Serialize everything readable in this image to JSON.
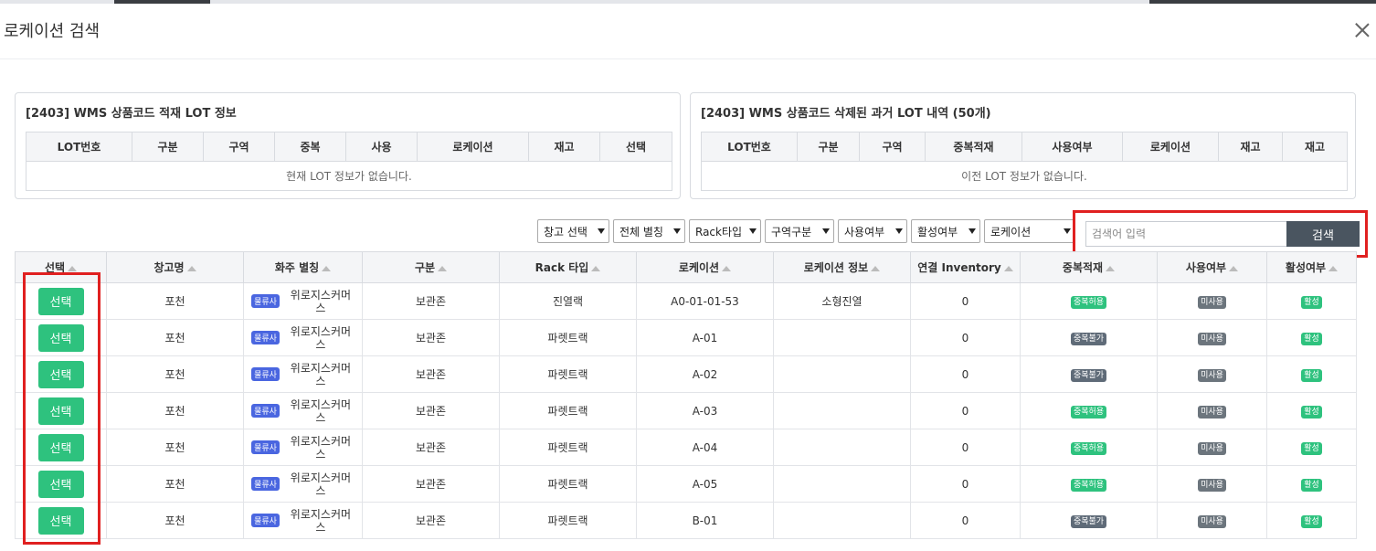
{
  "modal": {
    "title": "로케이션 검색"
  },
  "panel_current": {
    "title": "[2403] WMS 상품코드 적재 LOT 정보",
    "headers": [
      "LOT번호",
      "구분",
      "구역",
      "중복",
      "사용",
      "로케이션",
      "재고",
      "선택"
    ],
    "empty_message": "현재 LOT 정보가 없습니다."
  },
  "panel_history": {
    "title": "[2403] WMS 상품코드 삭제된 과거 LOT 내역 (50개)",
    "headers": [
      "LOT번호",
      "구분",
      "구역",
      "중복적재",
      "사용여부",
      "로케이션",
      "재고",
      "재고"
    ],
    "empty_message": "이전 LOT 정보가 없습니다."
  },
  "filters": [
    {
      "name": "warehouse-select",
      "value": "창고 선택"
    },
    {
      "name": "alias-select",
      "value": "전체 별칭"
    },
    {
      "name": "rack-type-select",
      "value": "Rack타입"
    },
    {
      "name": "zone-type-select",
      "value": "구역구분"
    },
    {
      "name": "usage-select",
      "value": "사용여부"
    },
    {
      "name": "active-select",
      "value": "활성여부"
    },
    {
      "name": "location-select",
      "value": "로케이션"
    }
  ],
  "search": {
    "placeholder": "검색어 입력",
    "button_label": "검색"
  },
  "table": {
    "headers": [
      "선택",
      "창고명",
      "화주 별칭",
      "구분",
      "Rack 타입",
      "로케이션",
      "로케이션 정보",
      "연결 Inventory",
      "중복적재",
      "사용여부",
      "활성여부"
    ],
    "rows": [
      {
        "select": "선택",
        "warehouse": "포천",
        "owner_badge": "물류사",
        "owner": "위로지스커머스",
        "type": "보관존",
        "rack": "진열랙",
        "location": "A0-01-01-53",
        "info": "소형진열",
        "inventory": "0",
        "dup": "중복허용",
        "dup_status": "allow",
        "use": "미사용",
        "active": "활성"
      },
      {
        "select": "선택",
        "warehouse": "포천",
        "owner_badge": "물류사",
        "owner": "위로지스커머스",
        "type": "보관존",
        "rack": "파렛트랙",
        "location": "A-01",
        "info": "",
        "inventory": "0",
        "dup": "중복불가",
        "dup_status": "deny",
        "use": "미사용",
        "active": "활성"
      },
      {
        "select": "선택",
        "warehouse": "포천",
        "owner_badge": "물류사",
        "owner": "위로지스커머스",
        "type": "보관존",
        "rack": "파렛트랙",
        "location": "A-02",
        "info": "",
        "inventory": "0",
        "dup": "중복불가",
        "dup_status": "deny",
        "use": "미사용",
        "active": "활성"
      },
      {
        "select": "선택",
        "warehouse": "포천",
        "owner_badge": "물류사",
        "owner": "위로지스커머스",
        "type": "보관존",
        "rack": "파렛트랙",
        "location": "A-03",
        "info": "",
        "inventory": "0",
        "dup": "중복허용",
        "dup_status": "allow",
        "use": "미사용",
        "active": "활성"
      },
      {
        "select": "선택",
        "warehouse": "포천",
        "owner_badge": "물류사",
        "owner": "위로지스커머스",
        "type": "보관존",
        "rack": "파렛트랙",
        "location": "A-04",
        "info": "",
        "inventory": "0",
        "dup": "중복허용",
        "dup_status": "allow",
        "use": "미사용",
        "active": "활성"
      },
      {
        "select": "선택",
        "warehouse": "포천",
        "owner_badge": "물류사",
        "owner": "위로지스커머스",
        "type": "보관존",
        "rack": "파렛트랙",
        "location": "A-05",
        "info": "",
        "inventory": "0",
        "dup": "중복허용",
        "dup_status": "allow",
        "use": "미사용",
        "active": "활성"
      },
      {
        "select": "선택",
        "warehouse": "포천",
        "owner_badge": "물류사",
        "owner": "위로지스커머스",
        "type": "보관존",
        "rack": "파렛트랙",
        "location": "B-01",
        "info": "",
        "inventory": "0",
        "dup": "중복불가",
        "dup_status": "deny",
        "use": "미사용",
        "active": "활성"
      }
    ]
  },
  "colors": {
    "select_button": "#2ec27e",
    "owner_badge": "#4a66e0",
    "dup_allow": "#2ec27e",
    "dup_deny": "#5f6b78",
    "unused": "#6c757d",
    "active": "#2ec27e",
    "highlight": "#e02020",
    "search_button": "#4a5560"
  }
}
